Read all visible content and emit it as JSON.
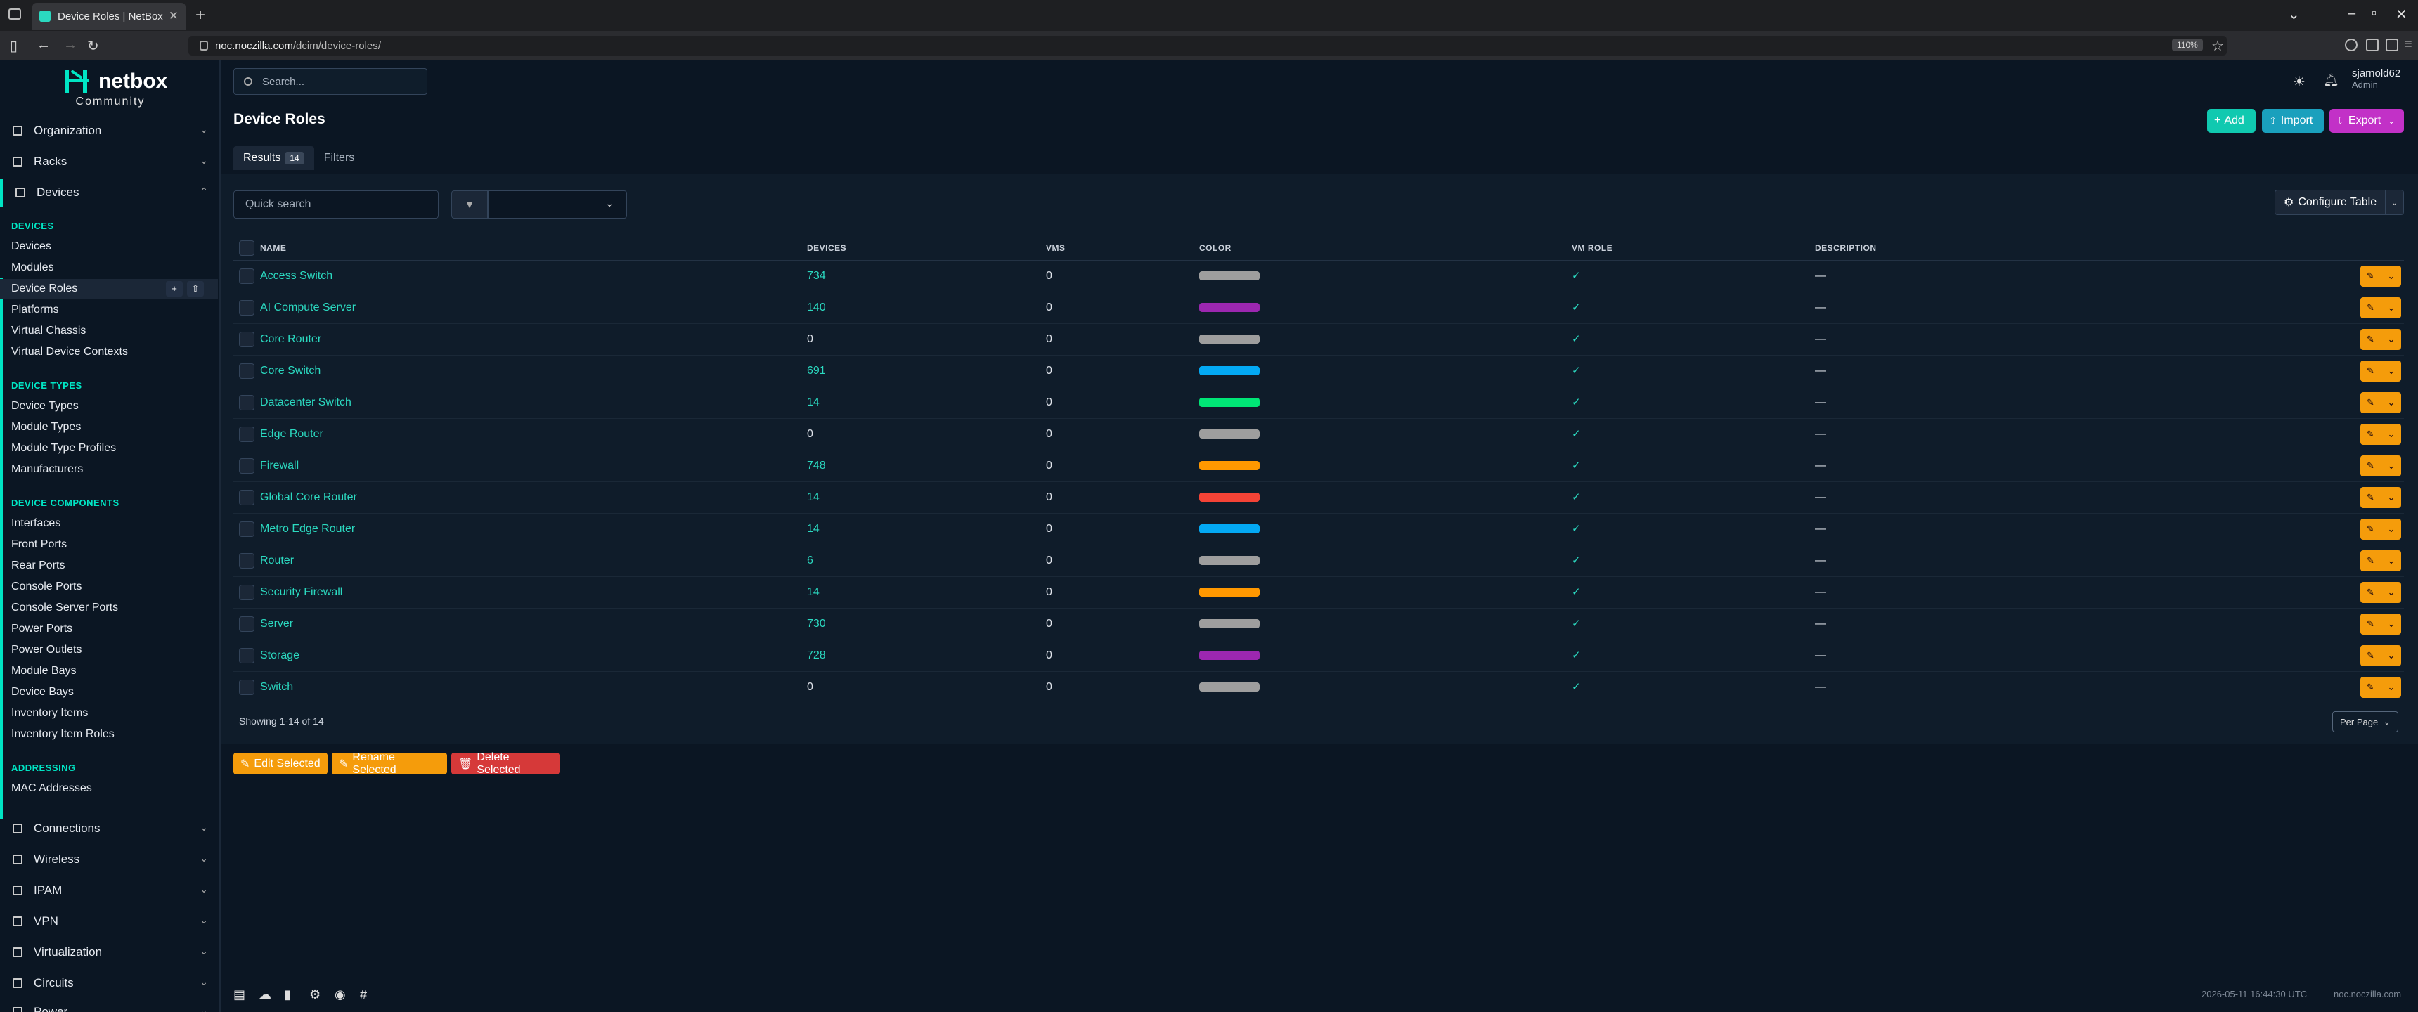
{
  "browser": {
    "tab_title": "Device Roles | NetBox",
    "url_host": "noc.noczilla.com",
    "url_path": "/dcim/device-roles/",
    "zoom": "110%"
  },
  "brand": {
    "name": "netbox",
    "edition": "Community",
    "accent": "#00e5c4"
  },
  "sidebar": {
    "organization": "Organization",
    "racks": "Racks",
    "devices": "Devices",
    "sections": {
      "devices": {
        "title": "DEVICES",
        "items": [
          "Devices",
          "Modules",
          "Device Roles",
          "Platforms",
          "Virtual Chassis",
          "Virtual Device Contexts"
        ]
      },
      "device_types": {
        "title": "DEVICE TYPES",
        "items": [
          "Device Types",
          "Module Types",
          "Module Type Profiles",
          "Manufacturers"
        ]
      },
      "device_components": {
        "title": "DEVICE COMPONENTS",
        "items": [
          "Interfaces",
          "Front Ports",
          "Rear Ports",
          "Console Ports",
          "Console Server Ports",
          "Power Ports",
          "Power Outlets",
          "Module Bays",
          "Device Bays",
          "Inventory Items",
          "Inventory Item Roles"
        ]
      },
      "addressing": {
        "title": "ADDRESSING",
        "items": [
          "MAC Addresses"
        ]
      }
    },
    "bottom_menus": [
      "Connections",
      "Wireless",
      "IPAM",
      "VPN",
      "Virtualization",
      "Circuits",
      "Power"
    ]
  },
  "header": {
    "search_placeholder": "Search...",
    "username": "sjarnold62",
    "user_role": "Admin"
  },
  "page": {
    "title": "Device Roles",
    "add": "Add",
    "import": "Import",
    "export": "Export",
    "tab_results": "Results",
    "results_count": "14",
    "tab_filters": "Filters",
    "quick_search_placeholder": "Quick search",
    "configure_table": "Configure Table"
  },
  "table": {
    "columns": [
      "NAME",
      "DEVICES",
      "VMS",
      "COLOR",
      "VM ROLE",
      "DESCRIPTION"
    ],
    "rows": [
      {
        "name": "Access Switch",
        "devices": "734",
        "vms": "0",
        "color": "#9e9e9e",
        "vm_role": "✓",
        "description": "—"
      },
      {
        "name": "AI Compute Server",
        "devices": "140",
        "vms": "0",
        "color": "#9c27b0",
        "vm_role": "✓",
        "description": "—"
      },
      {
        "name": "Core Router",
        "devices": "0",
        "vms": "0",
        "color": "#9e9e9e",
        "vm_role": "✓",
        "description": "—"
      },
      {
        "name": "Core Switch",
        "devices": "691",
        "vms": "0",
        "color": "#03a9f4",
        "vm_role": "✓",
        "description": "—"
      },
      {
        "name": "Datacenter Switch",
        "devices": "14",
        "vms": "0",
        "color": "#00e676",
        "vm_role": "✓",
        "description": "—"
      },
      {
        "name": "Edge Router",
        "devices": "0",
        "vms": "0",
        "color": "#9e9e9e",
        "vm_role": "✓",
        "description": "—"
      },
      {
        "name": "Firewall",
        "devices": "748",
        "vms": "0",
        "color": "#ff9800",
        "vm_role": "✓",
        "description": "—"
      },
      {
        "name": "Global Core Router",
        "devices": "14",
        "vms": "0",
        "color": "#f44336",
        "vm_role": "✓",
        "description": "—"
      },
      {
        "name": "Metro Edge Router",
        "devices": "14",
        "vms": "0",
        "color": "#03a9f4",
        "vm_role": "✓",
        "description": "—"
      },
      {
        "name": "Router",
        "devices": "6",
        "vms": "0",
        "color": "#9e9e9e",
        "vm_role": "✓",
        "description": "—"
      },
      {
        "name": "Security Firewall",
        "devices": "14",
        "vms": "0",
        "color": "#ff9800",
        "vm_role": "✓",
        "description": "—"
      },
      {
        "name": "Server",
        "devices": "730",
        "vms": "0",
        "color": "#9e9e9e",
        "vm_role": "✓",
        "description": "—"
      },
      {
        "name": "Storage",
        "devices": "728",
        "vms": "0",
        "color": "#9c27b0",
        "vm_role": "✓",
        "description": "—"
      },
      {
        "name": "Switch",
        "devices": "0",
        "vms": "0",
        "color": "#9e9e9e",
        "vm_role": "✓",
        "description": "—"
      }
    ],
    "showing": "Showing 1-14 of 14",
    "per_page": "Per Page"
  },
  "bulk": {
    "edit": "Edit Selected",
    "rename": "Rename Selected",
    "delete": "Delete Selected"
  },
  "footer": {
    "timestamp": "2026-05-11 16:44:30 UTC",
    "host": "noc.noczilla.com"
  }
}
